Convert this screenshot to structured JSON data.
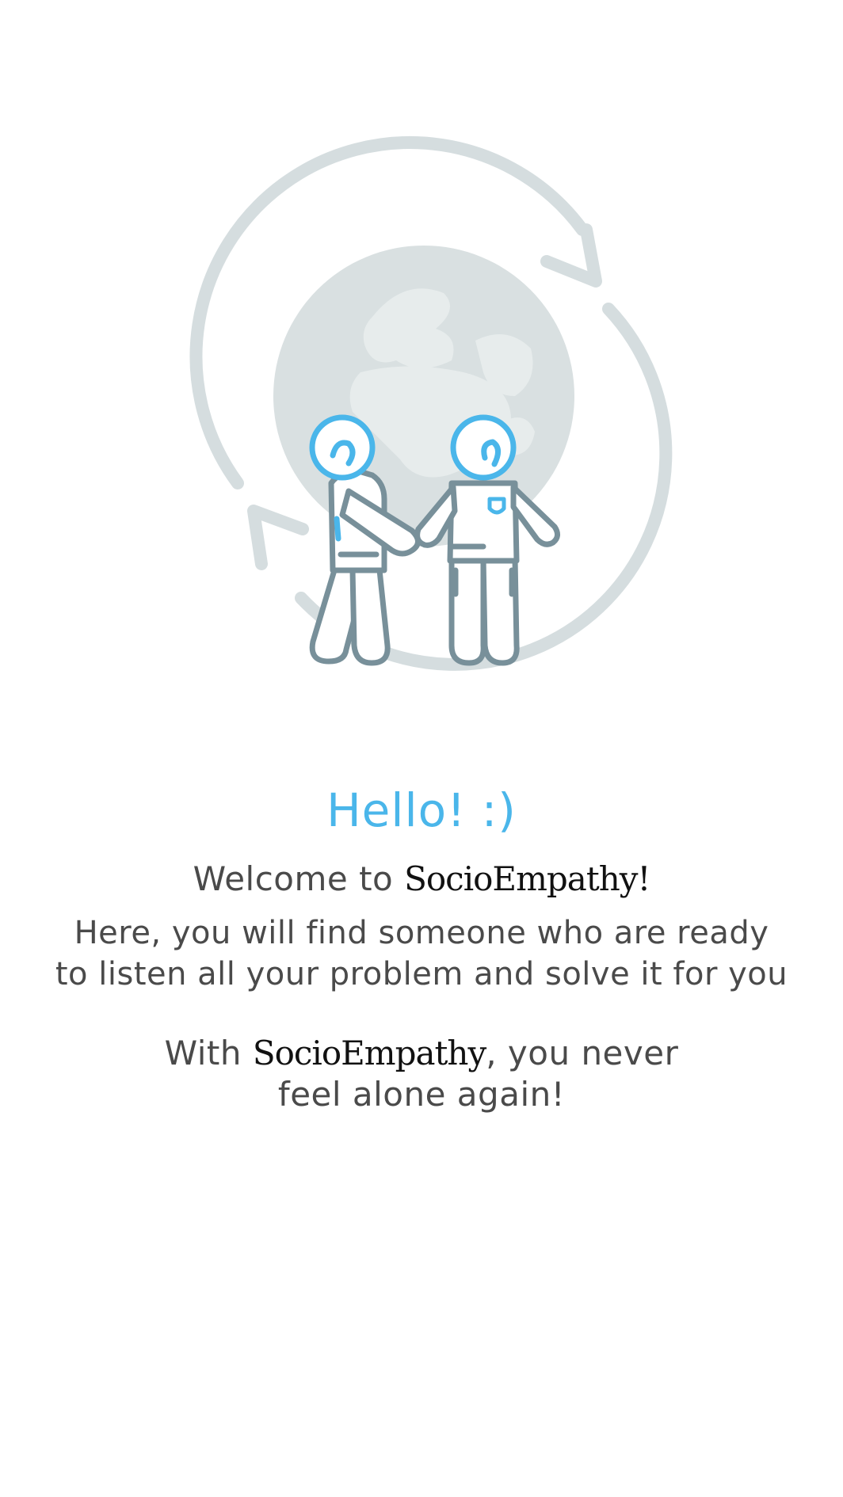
{
  "onboarding": {
    "greeting": "Hello! :)",
    "welcome_prefix": "Welcome to ",
    "welcome_brand": "SocioEmpathy!",
    "intro_line_1": "Here, you will find someone who are ready",
    "intro_line_2": "to listen all your problem and solve it for you",
    "closing_prefix": "With ",
    "closing_brand": "SocioEmpathy",
    "closing_suffix": ", you never",
    "closing_line_2": "feel alone again!"
  },
  "colors": {
    "accent_blue": "#4ab6ea",
    "text_gray": "#4a4a4a",
    "brand_black": "#111111",
    "globe_gray": "#d6dedf",
    "outline_gray": "#78909a"
  },
  "illustration": {
    "icon": "handshake-globe-illustration"
  }
}
